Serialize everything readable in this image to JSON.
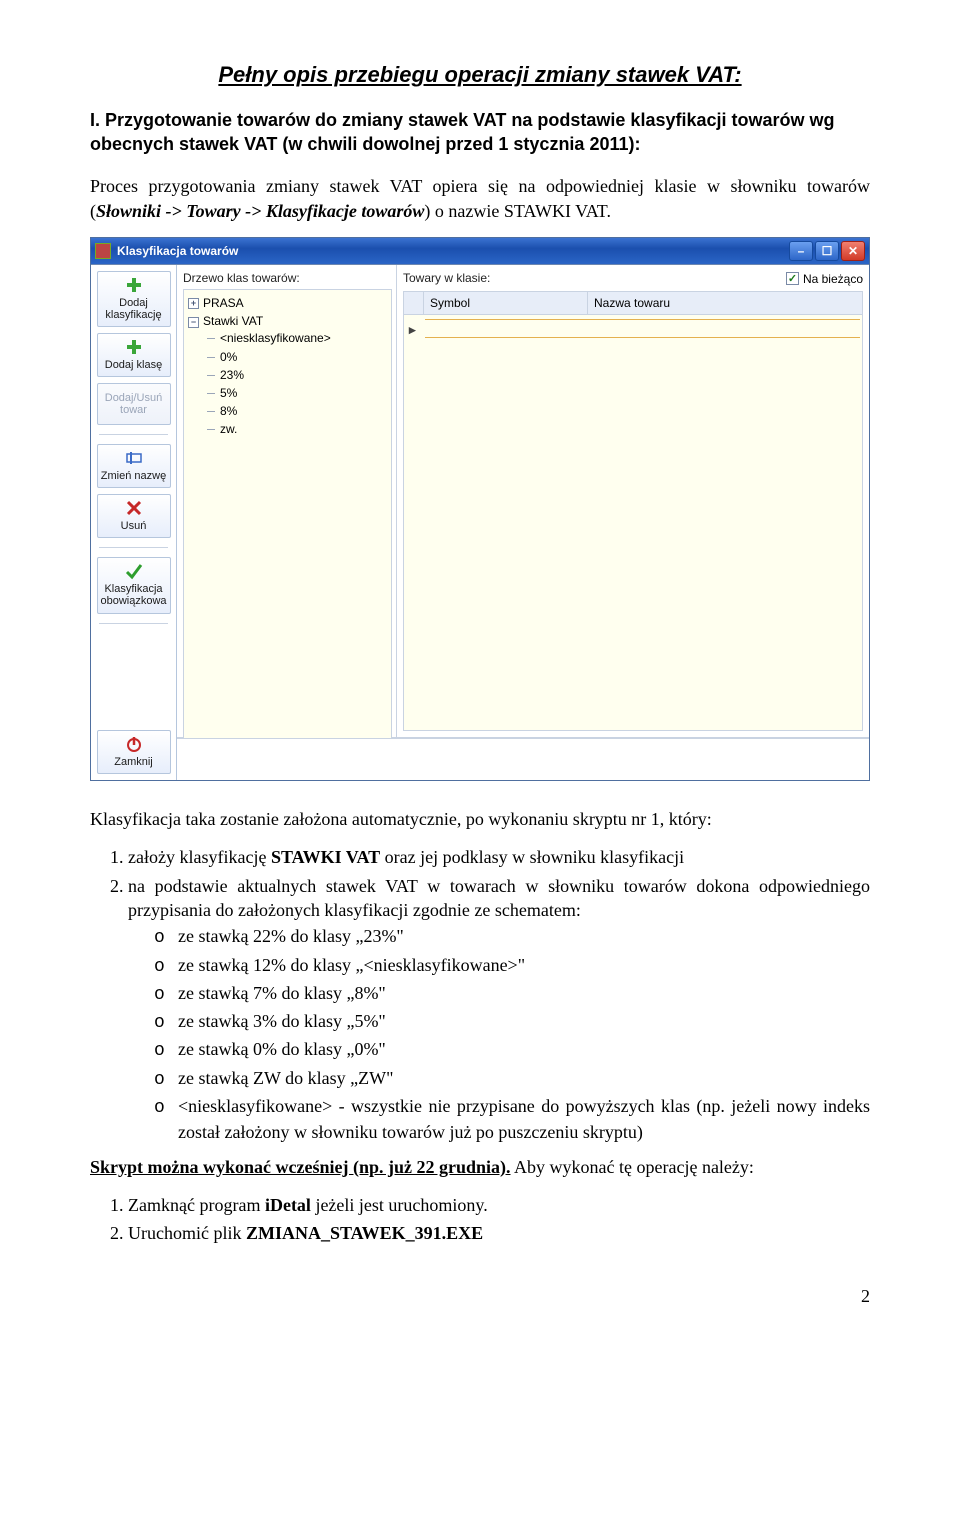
{
  "title": "Pełny opis przebiegu operacji zmiany stawek VAT:",
  "section1_heading": "I. Przygotowanie towarów do zmiany stawek VAT na podstawie klasyfikacji towarów wg obecnych stawek VAT (w chwili dowolnej przed 1 stycznia 2011):",
  "para1_a": "Proces przygotowania zmiany stawek VAT opiera się na odpowiedniej klasie w słowniku towarów (",
  "para1_b": "Słowniki -> Towary -> Klasyfikacje towarów",
  "para1_c": ") o nazwie STAWKI VAT.",
  "app": {
    "window_title": "Klasyfikacja towarów",
    "tree_label": "Drzewo klas towarów:",
    "grid_label": "Towary w klasie:",
    "on_the_fly": "Na bieżąco",
    "col_symbol": "Symbol",
    "col_name": "Nazwa towaru",
    "tree": {
      "node1": "PRASA",
      "node2": "Stawki VAT",
      "leaf1": "<niesklasyfikowane>",
      "leaf2": "0%",
      "leaf3": "23%",
      "leaf4": "5%",
      "leaf5": "8%",
      "leaf6": "zw."
    },
    "toolbar": {
      "add_class_tree": "Dodaj klasyfikację",
      "add_class": "Dodaj klasę",
      "add_remove_item": "Dodaj/Usuń towar",
      "rename": "Zmień nazwę",
      "delete": "Usuń",
      "required": "Klasyfikacja obowiązkowa",
      "close": "Zamknij"
    }
  },
  "para2": "Klasyfikacja taka zostanie założona automatycznie, po wykonaniu skryptu nr 1, który:",
  "num": {
    "i1_a": "założy klasyfikację ",
    "i1_b": "STAWKI VAT",
    "i1_c": " oraz jej podklasy w słowniku klasyfikacji",
    "i2": "na podstawie aktualnych stawek VAT w towarach w słowniku towarów dokona odpowiedniego przypisania do założonych klasyfikacji zgodnie ze schematem:"
  },
  "bul": {
    "b1": "ze stawką 22% do klasy „23%\"",
    "b2": "ze stawką 12% do klasy „<niesklasyfikowane>\"",
    "b3": "ze stawką 7% do klasy „8%\"",
    "b4": "ze stawką 3% do klasy „5%\"",
    "b5": "ze stawką 0% do klasy „0%\"",
    "b6": "ze stawką ZW do klasy „ZW\"",
    "b7": "<niesklasyfikowane> - wszystkie nie przypisane do powyższych klas (np. jeżeli nowy indeks został założony w słowniku towarów już po puszczeniu skryptu)"
  },
  "para3_a": "Skrypt można wykonać wcześniej (np. już 22 grudnia).",
  "para3_b": " Aby wykonać tę operację należy:",
  "steps": {
    "s1_a": "Zamknąć program ",
    "s1_b": "iDetal",
    "s1_c": " jeżeli jest uruchomiony.",
    "s2_a": "Uruchomić plik ",
    "s2_b": "ZMIANA_STAWEK_391.EXE"
  },
  "pagenum": "2"
}
